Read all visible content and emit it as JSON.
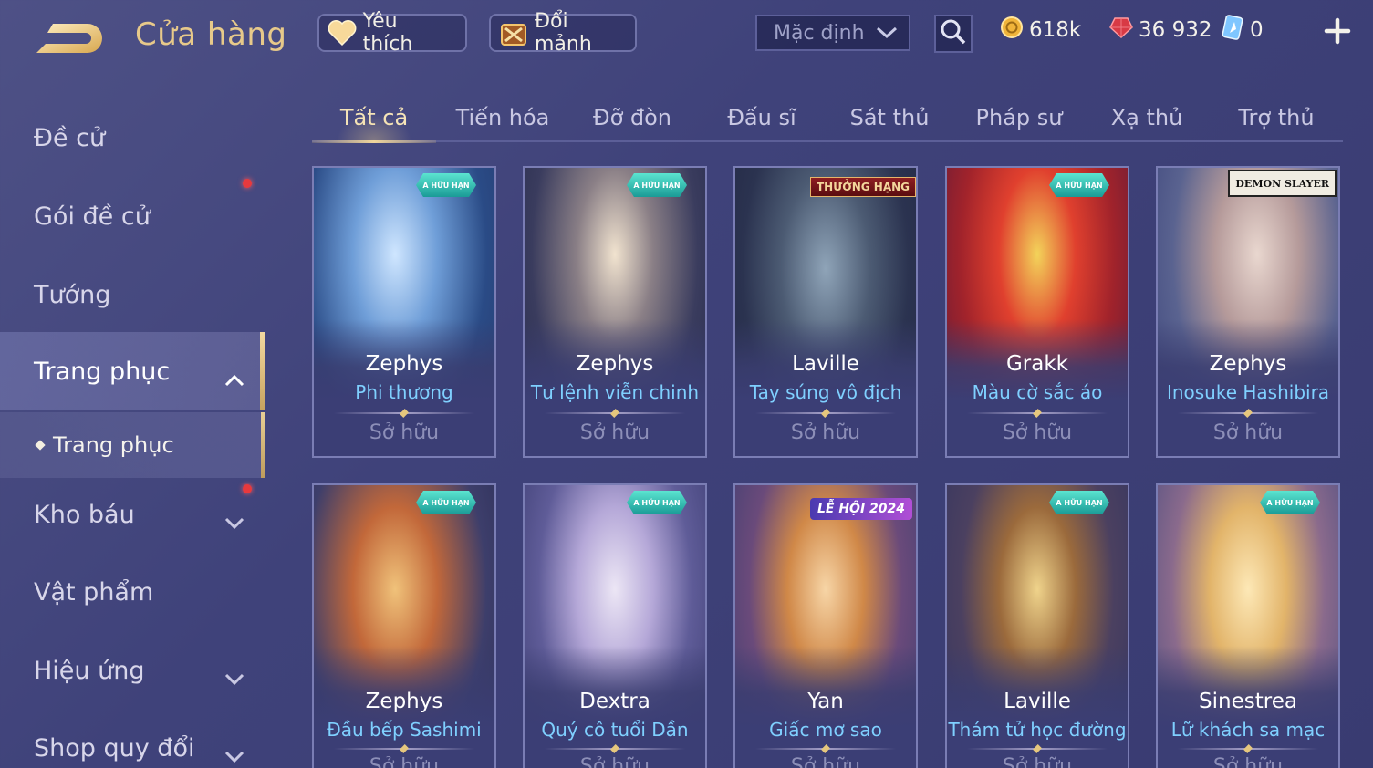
{
  "header": {
    "title": "Cửa hàng",
    "back_icon": "back-arrow-icon",
    "favorite_label": "Yêu thích",
    "favorite_icon": "heart-icon",
    "exchange_label": "Đổi mảnh",
    "exchange_icon": "fragment-chest-icon",
    "sort_value": "Mặc định",
    "search_icon": "search-icon",
    "currencies": {
      "gold": "618k",
      "gems": "36 932",
      "vouchers": "0"
    },
    "plus_icon": "plus-icon"
  },
  "sidebar": {
    "items": [
      {
        "label": "Đề cử"
      },
      {
        "label": "Gói đề cử",
        "notify": true
      },
      {
        "label": "Tướng"
      },
      {
        "label": "Trang phục",
        "expanded": true
      },
      {
        "label": "Kho báu",
        "notify": true
      },
      {
        "label": "Vật phẩm"
      },
      {
        "label": "Hiệu ứng"
      },
      {
        "label": "Shop quy đổi"
      }
    ],
    "sub_item": "Trang phục"
  },
  "tabs": [
    "Tất cả",
    "Tiến hóa",
    "Đỡ đòn",
    "Đấu sĩ",
    "Sát thủ",
    "Pháp sư",
    "Xạ thủ",
    "Trợ thủ"
  ],
  "active_tab": "Tất cả",
  "cards": [
    {
      "hero": "Zephys",
      "skin": "Phi thương",
      "status": "Sở hữu",
      "badge_text": "A HỮU HẠN"
    },
    {
      "hero": "Zephys",
      "skin": "Tư lệnh viễn chinh",
      "status": "Sở hữu",
      "badge_text": "A HỮU HẠN"
    },
    {
      "hero": "Laville",
      "skin": "Tay súng vô địch",
      "status": "Sở hữu",
      "badge_text": "THƯỞNG HẠNG"
    },
    {
      "hero": "Grakk",
      "skin": "Màu cờ sắc áo",
      "status": "Sở hữu",
      "badge_text": "A HỮU HẠN"
    },
    {
      "hero": "Zephys",
      "skin": "Inosuke Hashibira",
      "status": "Sở hữu",
      "badge_text": "DEMON SLAYER"
    },
    {
      "hero": "Zephys",
      "skin": "Đầu bếp Sashimi",
      "status": "Sở hữu",
      "badge_text": "A HỮU HẠN"
    },
    {
      "hero": "Dextra",
      "skin": "Quý cô tuổi Dần",
      "status": "Sở hữu",
      "badge_text": "A HỮU HẠN"
    },
    {
      "hero": "Yan",
      "skin": "Giấc mơ sao",
      "status": "Sở hữu",
      "badge_text": "LỄ HỘI 2024"
    },
    {
      "hero": "Laville",
      "skin": "Thám tử học đường",
      "status": "Sở hữu",
      "badge_text": "A HỮU HẠN"
    },
    {
      "hero": "Sinestrea",
      "skin": "Lữ khách sa mạc",
      "status": "Sở hữu",
      "badge_text": "A HỮU HẠN"
    }
  ],
  "colors": {
    "accent_gold": "#e7c98a",
    "skin_name_blue": "#7fd0ff",
    "owned_grey": "#8d8fb8",
    "background": "#43467e"
  }
}
